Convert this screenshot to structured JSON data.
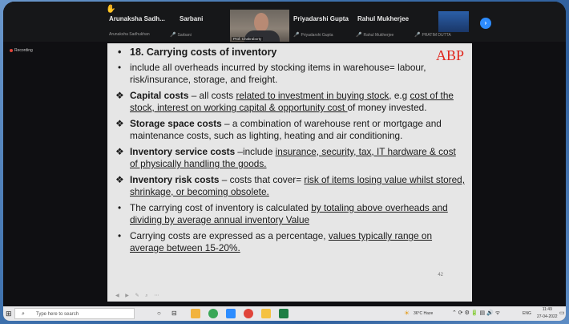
{
  "meeting": {
    "participants": [
      {
        "name": "Arunaksha Sadh...",
        "sub": "Arunaksha Sadhukhan"
      },
      {
        "name": "Sarbani",
        "sub": "Sarbani"
      },
      {
        "name": "",
        "sub": "Prof. Chakraborty"
      },
      {
        "name": "Priyadarshi Gupta",
        "sub": "Priyadarshi Gupta"
      },
      {
        "name": "Rahul Mukherjee",
        "sub": "Rahul Mukherjee"
      },
      {
        "name": "",
        "sub": "PRATIM DUTTA"
      }
    ],
    "recording_label": "Recording",
    "next_label": "›"
  },
  "slide": {
    "watermark": "ABP",
    "title": "18. Carrying costs of inventory",
    "intro_a": "include all  overheads incurred by stocking items in  warehouse= labour,",
    "intro_b": "risk/insurance, storage, and freight.",
    "capital_term": "Capital costs",
    "capital_a": " – all costs ",
    "capital_u1": "related to  investment in buying stock",
    "capital_b": ", e.g ",
    "capital_u2": "cost of the stock,  interest on working capital & opportunity cost ",
    "capital_c": "of  money invested.",
    "storage_term": "Storage space costs",
    "storage_text": " – a combination of  warehouse rent or mortgage and maintenance costs, such as lighting, heating and air conditioning.",
    "service_term": "Inventory service costs",
    "service_a": " –include ",
    "service_u": "insurance, security, tax, IT hardware & cost of physically handling the goods.",
    "risk_term": "Inventory risk costs",
    "risk_a": " – costs that cover= ",
    "risk_u": "risk of items losing value whilst stored, shrinkage, or becoming obsolete.",
    "calc_a": "The carrying cost of inventory is calculated ",
    "calc_u": "by totaling  above overheads and dividing by  average annual inventory Value",
    "pct_a": "Carrying costs are expressed as a percentage, ",
    "pct_u": "values typically range on average between 15-20%.",
    "page_number": "42",
    "tools": "◀ ▶ ✎ ⌕ ⋯"
  },
  "taskbar": {
    "search_placeholder": "Type here to search",
    "weather": "36°C  Haze",
    "lang": "ENG",
    "time": "11:49",
    "date": "27-04-2022"
  }
}
